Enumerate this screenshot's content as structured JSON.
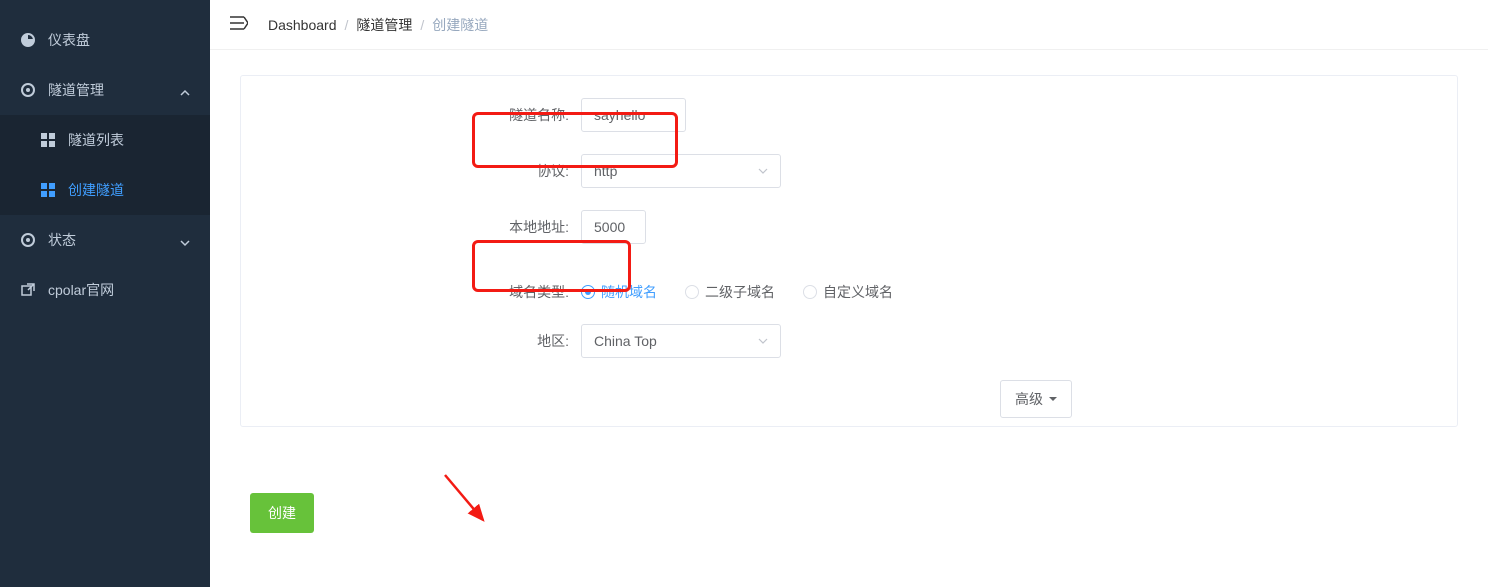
{
  "sidebar": {
    "items": [
      {
        "label": "仪表盘"
      },
      {
        "label": "隧道管理"
      },
      {
        "label": "状态"
      },
      {
        "label": "cpolar官网"
      }
    ],
    "sub": [
      {
        "label": "隧道列表"
      },
      {
        "label": "创建隧道"
      }
    ]
  },
  "breadcrumb": {
    "dashboard": "Dashboard",
    "tunnel_mgmt": "隧道管理",
    "create_tunnel": "创建隧道"
  },
  "form": {
    "tunnel_name_label": "隧道名称:",
    "tunnel_name_value": "sayhello",
    "protocol_label": "协议:",
    "protocol_value": "http",
    "local_addr_label": "本地地址:",
    "local_addr_value": "5000",
    "domain_type_label": "域名类型:",
    "domain_options": {
      "random": "随机域名",
      "sub": "二级子域名",
      "custom": "自定义域名"
    },
    "region_label": "地区:",
    "region_value": "China Top",
    "advanced_label": "高级",
    "create_label": "创建"
  },
  "colors": {
    "sidebar_bg": "#1f2d3d",
    "active": "#409eff",
    "highlight": "#f31b14",
    "create_btn": "#67c23a"
  }
}
